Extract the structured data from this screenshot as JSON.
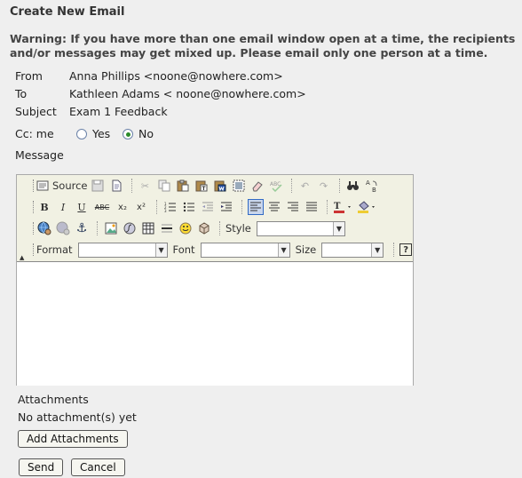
{
  "page": {
    "title": "Create New Email",
    "warning": "Warning: If you have more than one email window open at a time, the recipients and/or messages may get mixed up. Please email only one person at a time."
  },
  "form": {
    "from_label": "From",
    "from_value": "Anna Phillips <noone@nowhere.com>",
    "to_label": "To",
    "to_value": "Kathleen Adams < noone@nowhere.com>",
    "subject_label": "Subject",
    "subject_value": "Exam 1 Feedback",
    "cc_label": "Cc: me",
    "cc_yes": "Yes",
    "cc_no": "No",
    "cc_selected": "No",
    "message_label": "Message"
  },
  "editor": {
    "source_label": "Source",
    "style_label": "Style",
    "format_label": "Format",
    "font_label": "Font",
    "size_label": "Size",
    "style_value": "",
    "format_value": "",
    "font_value": "",
    "size_value": "",
    "body": "",
    "icons": {
      "bold": "B",
      "italic": "I",
      "underline": "U",
      "strike": "ABC",
      "subscript": "x₂",
      "superscript": "x²",
      "help": "?"
    }
  },
  "attachments": {
    "label": "Attachments",
    "empty_text": "No attachment(s) yet",
    "add_button": "Add Attachments"
  },
  "actions": {
    "send": "Send",
    "cancel": "Cancel"
  }
}
